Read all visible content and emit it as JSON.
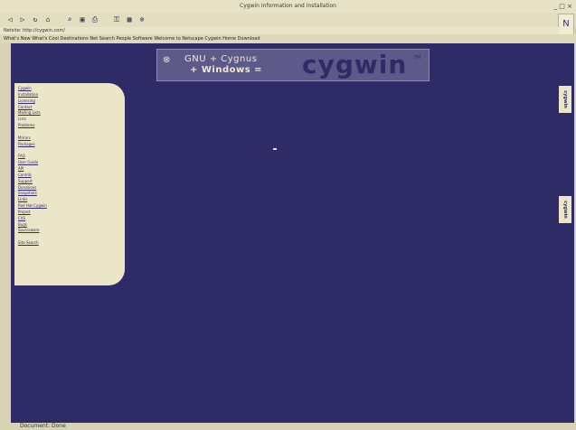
{
  "window": {
    "title": "Cygwin Information and Installation",
    "controls": "_ □ ×"
  },
  "toolbar": {
    "buttons": [
      {
        "name": "back",
        "glyph": "◁"
      },
      {
        "name": "forward",
        "glyph": "▷"
      },
      {
        "name": "reload",
        "glyph": "↻"
      },
      {
        "name": "home",
        "glyph": "⌂"
      },
      {
        "name": "search",
        "glyph": "⌕"
      },
      {
        "name": "netscape",
        "glyph": "▣"
      },
      {
        "name": "print",
        "glyph": "⎙"
      },
      {
        "name": "security",
        "glyph": "⚿"
      },
      {
        "name": "images",
        "glyph": "▦"
      },
      {
        "name": "stop",
        "glyph": "⊗"
      }
    ],
    "throbber_glyph": "N"
  },
  "address": {
    "label": "Netsite: http://cygwin.com/"
  },
  "links_bar": {
    "text": "What's New   What's Cool   Destinations   Net Search   People   Software   Welcome to Netscape   Cygwin Home   Download"
  },
  "banner": {
    "logo_glyph": "⊗",
    "line1": "GNU + Cygnus",
    "line2": "+ Windows =",
    "brand": "cygwin",
    "tm": "TM"
  },
  "sidebar": {
    "items": [
      {
        "label": "Cygwin",
        "link": true
      },
      {
        "label": "Installation",
        "link": true
      },
      {
        "label": "Licensing",
        "link": true
      },
      {
        "label": "Contact",
        "link": true
      },
      {
        "label": "Mailing Lists",
        "link": true
      },
      {
        "label": "Lists",
        "link": false
      },
      {
        "label": "Problems",
        "link": true
      },
      {
        "label": "",
        "link": false
      },
      {
        "label": "Mirrors",
        "link": true
      },
      {
        "label": "Packages",
        "link": true
      },
      {
        "label": "",
        "link": false
      },
      {
        "label": "FAQ",
        "link": true
      },
      {
        "label": "User Guide",
        "link": true
      },
      {
        "label": "API",
        "link": true
      },
      {
        "label": "Contrib",
        "link": true
      },
      {
        "label": "Support",
        "link": true
      },
      {
        "label": "Donations",
        "link": true
      },
      {
        "label": "Snapshots",
        "link": true
      },
      {
        "label": "Links",
        "link": true
      },
      {
        "label": "Red Hat Cygwin",
        "link": true
      },
      {
        "label": "Project",
        "link": true
      },
      {
        "label": "CVS",
        "link": true
      },
      {
        "label": "Bugs",
        "link": true
      },
      {
        "label": "Sourceware",
        "link": true
      },
      {
        "label": "",
        "link": false
      },
      {
        "label": "Site Search",
        "link": true
      }
    ]
  },
  "badges": {
    "top": "cygwin",
    "bottom": "cygwin"
  },
  "status": {
    "text": "Document: Done"
  }
}
